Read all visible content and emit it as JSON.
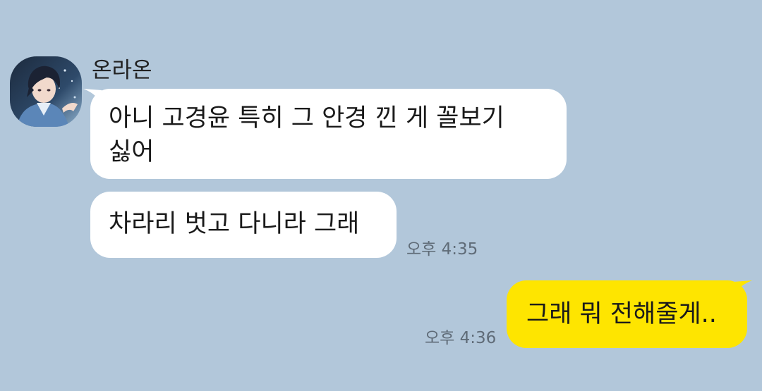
{
  "chat": {
    "sender_name": "온라온",
    "messages": [
      {
        "direction": "incoming",
        "text": "아니 고경윤 특히 그 안경 낀 게 꼴보기\n싫어",
        "time": ""
      },
      {
        "direction": "incoming",
        "text": "차라리 벗고 다니라 그래",
        "time": "오후 4:35"
      },
      {
        "direction": "outgoing",
        "text": "그래 뭐 전해줄게..",
        "time": "오후 4:36"
      }
    ]
  },
  "colors": {
    "background": "#b2c7da",
    "incoming_bubble": "#ffffff",
    "outgoing_bubble": "#fee500",
    "timestamp": "#5f6b77"
  },
  "icons": {
    "avatar": "profile-picture-anime-boy"
  }
}
